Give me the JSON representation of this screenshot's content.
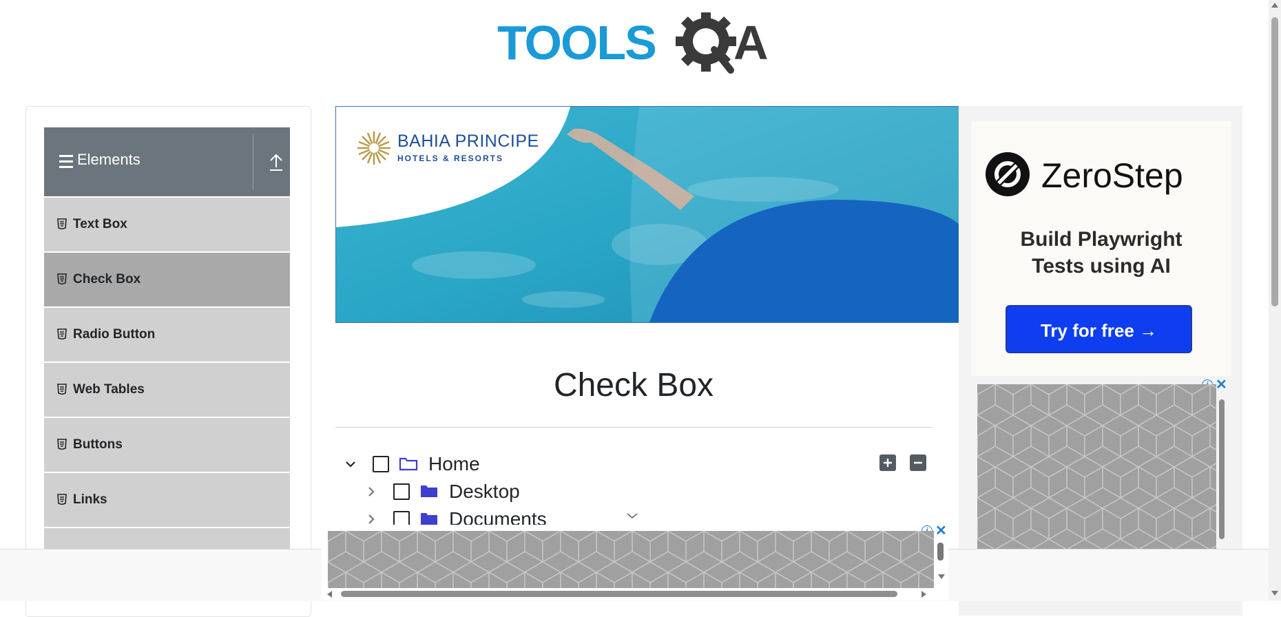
{
  "header": {
    "logo_text": "TOOLSQA"
  },
  "sidebar": {
    "group_title": "Elements",
    "items": [
      {
        "label": "Text Box",
        "active": false
      },
      {
        "label": "Check Box",
        "active": true
      },
      {
        "label": "Radio Button",
        "active": false
      },
      {
        "label": "Web Tables",
        "active": false
      },
      {
        "label": "Buttons",
        "active": false
      },
      {
        "label": "Links",
        "active": false
      }
    ]
  },
  "banner_ad": {
    "brand_line1": "BAHIA PRINCIPE",
    "brand_line2": "HOTELS & RESORTS"
  },
  "main": {
    "title": "Check Box",
    "tree": [
      {
        "label": "Home",
        "expanded": true,
        "level": 0
      },
      {
        "label": "Desktop",
        "expanded": false,
        "level": 1
      },
      {
        "label": "Documents",
        "expanded": false,
        "level": 1
      }
    ]
  },
  "right_ad": {
    "brand": "ZeroStep",
    "tagline_line1": "Build Playwright",
    "tagline_line2": "Tests using AI",
    "cta": "Try for free →"
  },
  "colors": {
    "sidebar_header": "#6c757d",
    "sidebar_item": "#d0d0d0",
    "sidebar_item_active": "#a9a9a9",
    "logo_blue": "#1a9ad6",
    "logo_dark": "#3a3a3a",
    "cta_blue": "#0e3ef0",
    "folder_blue": "#3e3ed0"
  }
}
